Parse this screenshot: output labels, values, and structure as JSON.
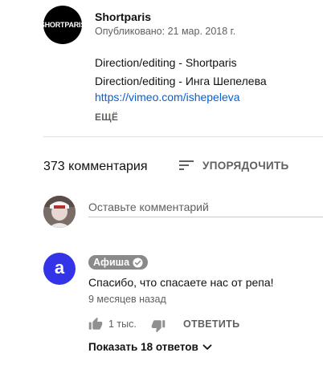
{
  "video": {
    "channel": {
      "avatar_text": "SHORTPARIS",
      "name": "Shortparis",
      "published": "Опубликовано: 21 мар. 2018 г."
    },
    "description": {
      "lines": [
        "Direction/editing - Shortparis",
        "Direction/editing - Инга Шепелева"
      ],
      "link": "https://vimeo.com/ishepeleva",
      "more_label": "ЕЩЁ"
    }
  },
  "comments": {
    "count_label": "373 комментария",
    "sort_label": "УПОРЯДОЧИТЬ",
    "sort_icon": "sort-icon",
    "add_placeholder": "Оставьте комментарий",
    "items": [
      {
        "author": "Афиша",
        "author_avatar_letter": "a",
        "avatar_color": "#3333e8",
        "verified_icon": "verified-check-icon",
        "text": "Спасибо, что спасаете нас от репа!",
        "time": "9 месяцев назад",
        "likes": "1 тыс.",
        "reply_label": "ОТВЕТИТЬ",
        "show_replies_label": "Показать 18 ответов"
      }
    ]
  },
  "colors": {
    "link": "#065fd4",
    "secondary_text": "#606060",
    "author_badge": "#8a8a8a"
  }
}
